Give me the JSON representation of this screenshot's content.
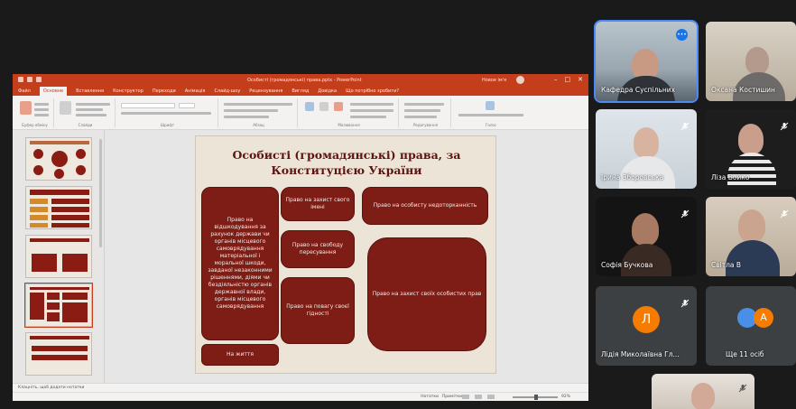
{
  "presentation": {
    "window_title": "Особисті (громадянські) права.pptx - PowerPoint",
    "user_label": "Новое ім'я",
    "tabs": [
      "Файл",
      "Основне",
      "Вставлення",
      "Конструктор",
      "Переходи",
      "Анімація",
      "Слайд-шоу",
      "Рецензування",
      "Вигляд",
      "Довідка",
      "Що потрібно зробити?"
    ],
    "ribbon_groups": [
      "Буфер обміну",
      "Слайди",
      "Шрифт",
      "Абзац",
      "Малювання",
      "Редагування",
      "Голос"
    ],
    "slide": {
      "title": "Особисті (громадянські) права, за Конституцією України",
      "boxes": {
        "box1": "Право на відшкодування за рахунок держави чи органів місцевого самоврядування матеріальної і моральної шкоди, завданої незаконними рішеннями, діями чи бездіяльністю органів державної влади, органів місцевого самоврядування",
        "box2": "Право на захист свого імені",
        "box3": "Право на свободу пересування",
        "box4": "Право на повагу своєї гідності",
        "box5": "Право на особисту недоторканність",
        "box6": "Право на захист своїх особистих прав",
        "box7": "На життя"
      }
    },
    "notes_placeholder": "Клацніть, щоб додати нотатки",
    "status": {
      "notes_label": "Нотатки",
      "comments_label": "Примітки",
      "zoom": "92%"
    }
  },
  "participants": [
    {
      "name": "Кафедра Суспільних",
      "speaking": true
    },
    {
      "name": "Оксана Костишин",
      "speaking": false
    },
    {
      "name": "Ірина Зборовська",
      "speaking": false
    },
    {
      "name": "Ліза Бойко",
      "speaking": false
    },
    {
      "name": "Софія Бучкова",
      "speaking": false
    },
    {
      "name": "Світла В",
      "speaking": false
    },
    {
      "name": "Лідія Миколаївна Гл...",
      "initial": "Л",
      "speaking": false
    },
    {
      "name": "Ще 11 осіб",
      "initial": "A",
      "speaking": false
    }
  ]
}
